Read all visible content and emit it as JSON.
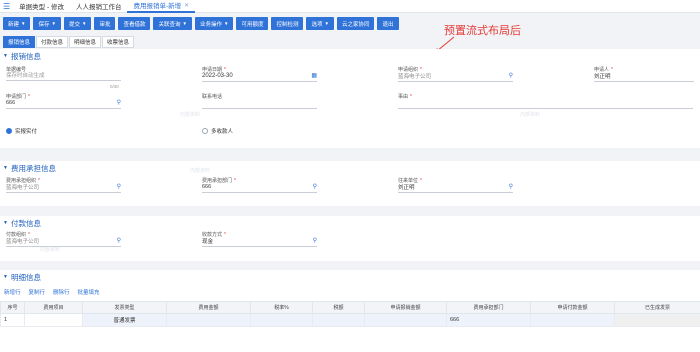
{
  "tabs": [
    {
      "label": "单据类型 - 修改",
      "active": false
    },
    {
      "label": "人人报销工作台",
      "active": false
    },
    {
      "label": "费用报销单-新增",
      "active": true
    }
  ],
  "toolbar": [
    {
      "label": "新建",
      "caret": true
    },
    {
      "label": "保存",
      "caret": true
    },
    {
      "label": "提交",
      "caret": true
    },
    {
      "label": "审批",
      "caret": false
    },
    {
      "label": "查看借款",
      "caret": false
    },
    {
      "label": "关联查询",
      "caret": true
    },
    {
      "label": "业务操作",
      "caret": true
    },
    {
      "label": "可用额度",
      "caret": false
    },
    {
      "label": "控制检测",
      "caret": false
    },
    {
      "label": "选项",
      "caret": true
    },
    {
      "label": "云之家协同",
      "caret": false
    },
    {
      "label": "退出",
      "caret": false
    }
  ],
  "annotation": "预置流式布局后",
  "subtabs": [
    "报销信息",
    "付款信息",
    "明细信息",
    "收票信息"
  ],
  "sections": {
    "reimburse": "报销信息",
    "expense": "费用承担信息",
    "payment": "付款信息",
    "detail": "明细信息"
  },
  "reimburse": {
    "bill_no_label": "单据编号",
    "bill_no_placeholder": "保存时自动生成",
    "apply_date_label": "申请日期",
    "apply_date_value": "2022-03-30",
    "apply_org_label": "申请组织",
    "apply_org_value": "蓝海电子公司",
    "applicant_label": "申请人",
    "applicant_value": "刘正明",
    "dept_label": "申请部门",
    "dept_value": "666",
    "counter": "0/30",
    "contact_label": "联系电话",
    "reason_label": "事由",
    "radio_actual": "实报实付",
    "radio_multi": "多收款人"
  },
  "expense": {
    "org_label": "费用承担组织",
    "org_value": "蓝海电子公司",
    "dept_label": "费用承担部门",
    "dept_value": "666",
    "unit_label": "往来单位",
    "unit_value": "刘正明"
  },
  "payment": {
    "org_label": "付款组织",
    "org_value": "蓝海电子公司",
    "method_label": "收款方式",
    "method_value": "现金"
  },
  "detail": {
    "actions": [
      "新增行",
      "复制行",
      "删除行",
      "批量填充"
    ],
    "columns": [
      "序号",
      "费用项目",
      "发票类型",
      "费用金额",
      "税率%",
      "税额",
      "申请报销金额",
      "费用承担部门",
      "申请付款金额",
      "已生成发票"
    ],
    "rows": [
      [
        "1",
        "",
        "普通发票",
        "",
        "",
        "",
        "",
        "666",
        "",
        ""
      ]
    ]
  },
  "watermark": "内部资料"
}
